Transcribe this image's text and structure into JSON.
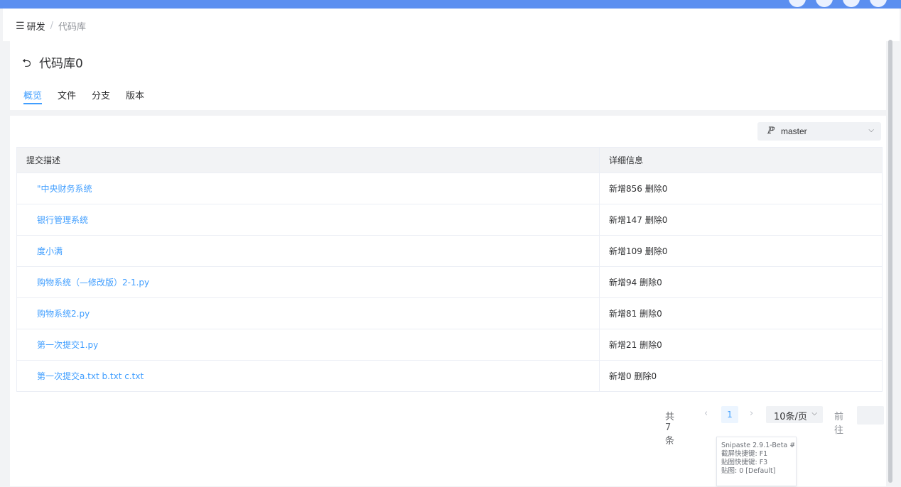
{
  "breadcrumb": {
    "menu_icon": "menu-icon",
    "section": "研发",
    "separator": "/",
    "current": "代码库"
  },
  "header": {
    "back_icon": "back-arrow-icon",
    "title": "代码库0"
  },
  "tabs": [
    {
      "label": "概览",
      "active": true
    },
    {
      "label": "文件",
      "active": false
    },
    {
      "label": "分支",
      "active": false
    },
    {
      "label": "版本",
      "active": false
    }
  ],
  "branch_select": {
    "icon": "branch-icon",
    "value": "master"
  },
  "table": {
    "columns": [
      "提交描述",
      "详细信息"
    ],
    "rows": [
      {
        "desc": "\"中央财务系统",
        "info": "新增856 删除0"
      },
      {
        "desc": "银行管理系统",
        "info": "新增147 删除0"
      },
      {
        "desc": "度小满",
        "info": "新增109 删除0"
      },
      {
        "desc": "购物系统（—修改版）2-1.py",
        "info": "新增94 删除0"
      },
      {
        "desc": "购物系统2.py",
        "info": "新增81 删除0"
      },
      {
        "desc": "第一次提交1.py",
        "info": "新增21 删除0"
      },
      {
        "desc": "第一次提交a.txt b.txt c.txt",
        "info": "新增0 删除0"
      }
    ]
  },
  "pagination": {
    "total_text": "共 7 条",
    "prev": "‹",
    "current_page": "1",
    "next": "›",
    "page_size": "10条/页",
    "goto_label": "前往"
  },
  "tooltip": {
    "lines": [
      "Snipaste 2.9.1-Beta #",
      "截屏快捷键: F1",
      "贴图快捷键: F3",
      "贴图: 0 [Default]"
    ]
  },
  "colors": {
    "accent": "#409eff",
    "topbar": "#5b8ff0"
  }
}
